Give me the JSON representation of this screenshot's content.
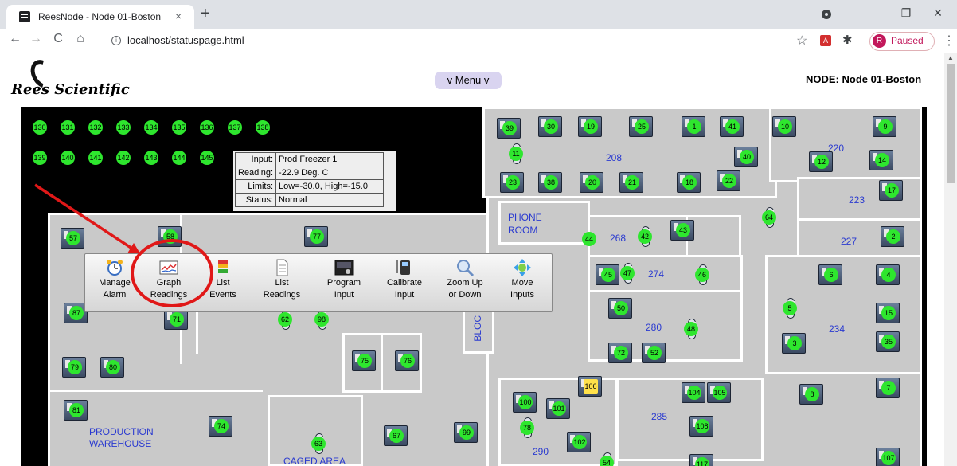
{
  "browser": {
    "tab_title": "ReesNode - Node 01-Boston",
    "tab_close": "×",
    "new_tab": "+",
    "url": "localhost/statuspage.html",
    "profile_avatar": "R",
    "profile_status": "Paused",
    "minimize": "–",
    "restore": "❐",
    "close": "✕",
    "back": "←",
    "forward": "→",
    "reload": "C",
    "home": "⌂",
    "star": "☆",
    "puzzle": "✱",
    "kebab": "⋮"
  },
  "header": {
    "logo_text": "Rees Scientific",
    "menu_button": "v Menu v",
    "node_title": "NODE: Node 01-Boston"
  },
  "rooms": {
    "r208": "208",
    "r220": "220",
    "r223": "223",
    "r227": "227",
    "r268": "268",
    "r274": "274",
    "r280": "280",
    "r234": "234",
    "r285": "285",
    "r290": "290",
    "phone_room_1": "PHONE",
    "phone_room_2": "ROOM",
    "blo": "BLOC",
    "production_1": "PRODUCTION",
    "production_2": "WAREHOUSE",
    "caged": "CAGED AREA"
  },
  "sensor_labels": {
    "s130": "130",
    "s131": "131",
    "s132": "132",
    "s133": "133",
    "s134": "134",
    "s135": "135",
    "s136": "136",
    "s137": "137",
    "s138": "138",
    "s139": "139",
    "s140": "140",
    "s141": "141",
    "s142": "142",
    "s143": "143",
    "s144": "144",
    "s145": "145",
    "s39": "39",
    "s30": "30",
    "s19": "19",
    "s25": "25",
    "s1": "1",
    "s41": "41",
    "s10": "10",
    "s9": "9",
    "s11": "11",
    "s40": "40",
    "s12": "12",
    "s14": "14",
    "s23": "23",
    "s38": "38",
    "s20": "20",
    "s21": "21",
    "s18": "18",
    "s22": "22",
    "s17": "17",
    "s64": "64",
    "s2": "2",
    "s44": "44",
    "s42": "42",
    "s43": "43",
    "s57": "57",
    "s58": "58",
    "s77": "77",
    "s6": "6",
    "s4": "4",
    "s45": "45",
    "s47": "47",
    "s46": "46",
    "s50": "50",
    "s5": "5",
    "s15": "15",
    "s48": "48",
    "s87": "87",
    "s71": "71",
    "s62": "62",
    "s98": "98",
    "s3": "3",
    "s35": "35",
    "s72": "72",
    "s52": "52",
    "s75": "75",
    "s76": "76",
    "s79": "79",
    "s80": "80",
    "s106": "106",
    "s104": "104",
    "s105": "105",
    "s7": "7",
    "s100": "100",
    "s101": "101",
    "s8": "8",
    "s81": "81",
    "s74": "74",
    "s78": "78",
    "s108": "108",
    "s99": "99",
    "s67": "67",
    "s102": "102",
    "s63": "63",
    "s107": "107",
    "s54": "54",
    "s117": "117"
  },
  "tooltip": {
    "input_label": "Input:",
    "input_value": "Prod Freezer 1",
    "reading_label": "Reading:",
    "reading_value": "-22.9 Deg. C",
    "limits_label": "Limits:",
    "limits_value": "Low=-30.0, High=-15.0",
    "status_label": "Status:",
    "status_value": "Normal"
  },
  "popup_menu": {
    "manage_1": "Manage",
    "manage_2": "Alarm",
    "graph_1": "Graph",
    "graph_2": "Readings",
    "events_1": "List",
    "events_2": "Events",
    "lreadings_1": "List",
    "lreadings_2": "Readings",
    "program_1": "Program",
    "program_2": "Input",
    "calibrate_1": "Calibrate",
    "calibrate_2": "Input",
    "zoom_1": "Zoom Up",
    "zoom_2": "or Down",
    "move_1": "Move",
    "move_2": "Inputs"
  },
  "colors": {
    "sensor_ok": "#2ee62e",
    "sensor_warn": "#ffe14a",
    "room_label": "#2a3ad0",
    "annotation": "#e01818",
    "menu_button_bg": "#d9d4f0"
  }
}
